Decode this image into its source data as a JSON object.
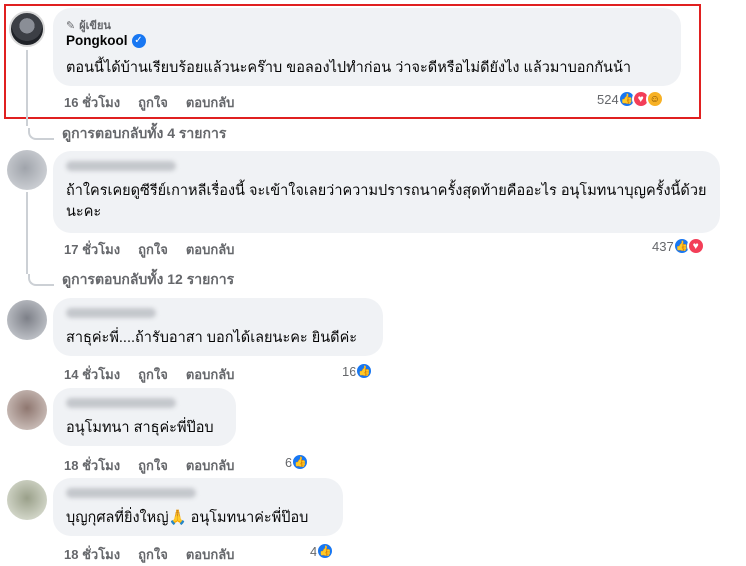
{
  "comments": [
    {
      "author_tag": "ผู้เขียน",
      "author": "Pongkool",
      "text": "ตอนนี้ได้บ้านเรียบร้อยแล้วนะคร๊าบ ขอลองไปทำก่อน ว่าจะดีหรือไม่ดียังไง แล้วมาบอกกันน้า",
      "time": "16 ชั่วโมง",
      "like": "ถูกใจ",
      "reply": "ตอบกลับ",
      "reaction_count": "524"
    },
    {
      "text": "ถ้าใครเคยดูซีรีย์เกาหลีเรื่องนี้ จะเข้าใจเลยว่าความปรารถนาครั้งสุดท้ายคืออะไร อนุโมทนาบุญครั้งนี้ด้วยนะคะ",
      "time": "17 ชั่วโมง",
      "like": "ถูกใจ",
      "reply": "ตอบกลับ",
      "reaction_count": "437"
    },
    {
      "text": "สาธุค่ะพี่....ถ้ารับอาสา บอกได้เลยนะคะ ยินดีค่ะ",
      "time": "14 ชั่วโมง",
      "like": "ถูกใจ",
      "reply": "ตอบกลับ",
      "reaction_count": "16"
    },
    {
      "text": "อนุโมทนา สาธุค่ะพี่ป๊อบ",
      "time": "18 ชั่วโมง",
      "like": "ถูกใจ",
      "reply": "ตอบกลับ",
      "reaction_count": "6"
    },
    {
      "text": "บุญกุศลที่ยิ่งใหญ่🙏 อนุโมทนาค่ะพี่ป๊อบ",
      "time": "18 ชั่วโมง",
      "like": "ถูกใจ",
      "reply": "ตอบกลับ",
      "reaction_count": "4"
    }
  ],
  "view_replies": [
    "ดูการตอบกลับทั้ง 4 รายการ",
    "ดูการตอบกลับทั้ง 12 รายการ"
  ],
  "icons": {
    "author_tag": "pencil-icon",
    "verified": "verified-badge-icon",
    "like_reaction": "like-reaction-icon",
    "love_reaction": "love-reaction-icon",
    "care_reaction": "care-reaction-icon"
  },
  "colors": {
    "highlight": "#e02020",
    "bubble": "#f0f2f5",
    "verified": "#1877f2"
  }
}
